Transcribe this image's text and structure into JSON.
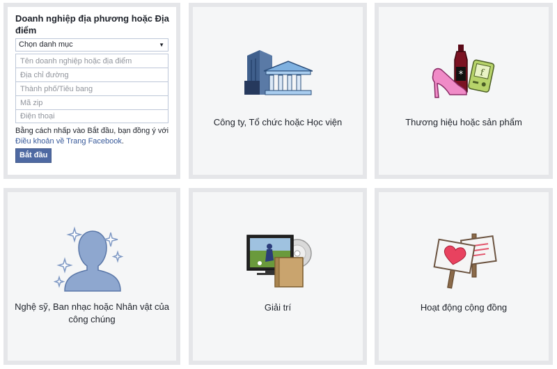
{
  "local_business": {
    "title": "Doanh nghiệp địa phương hoặc Địa điểm",
    "category_select": "Chọn danh mục",
    "placeholders": {
      "business_name": "Tên doanh nghiệp hoặc địa điểm",
      "address": "Địa chỉ đường",
      "city_state": "Thành phố/Tiêu bang",
      "zip": "Mã zip",
      "phone": "Điện thoại"
    },
    "terms_prefix": "Bằng cách nhấp vào Bắt đầu, bạn đồng ý với",
    "terms_link": "Điều khoản về Trang Facebook",
    "terms_suffix": ".",
    "start_button": "Bắt đầu"
  },
  "categories": [
    {
      "label": "Công ty, Tổ chức hoặc Học viện",
      "icon": "company-building-icon"
    },
    {
      "label": "Thương hiệu hoặc sản phẩm",
      "icon": "brand-product-icon"
    },
    {
      "label": "Nghệ sỹ, Ban nhạc hoặc Nhân vật của công chúng",
      "icon": "artist-silhouette-icon"
    },
    {
      "label": "Giải trí",
      "icon": "entertainment-media-icon"
    },
    {
      "label": "Hoạt động cộng đồng",
      "icon": "community-signs-icon"
    }
  ],
  "colors": {
    "tile_border": "#e5e6e9",
    "tile_bg": "#f5f6f7",
    "button_bg": "#4e69a2",
    "link": "#365899"
  }
}
